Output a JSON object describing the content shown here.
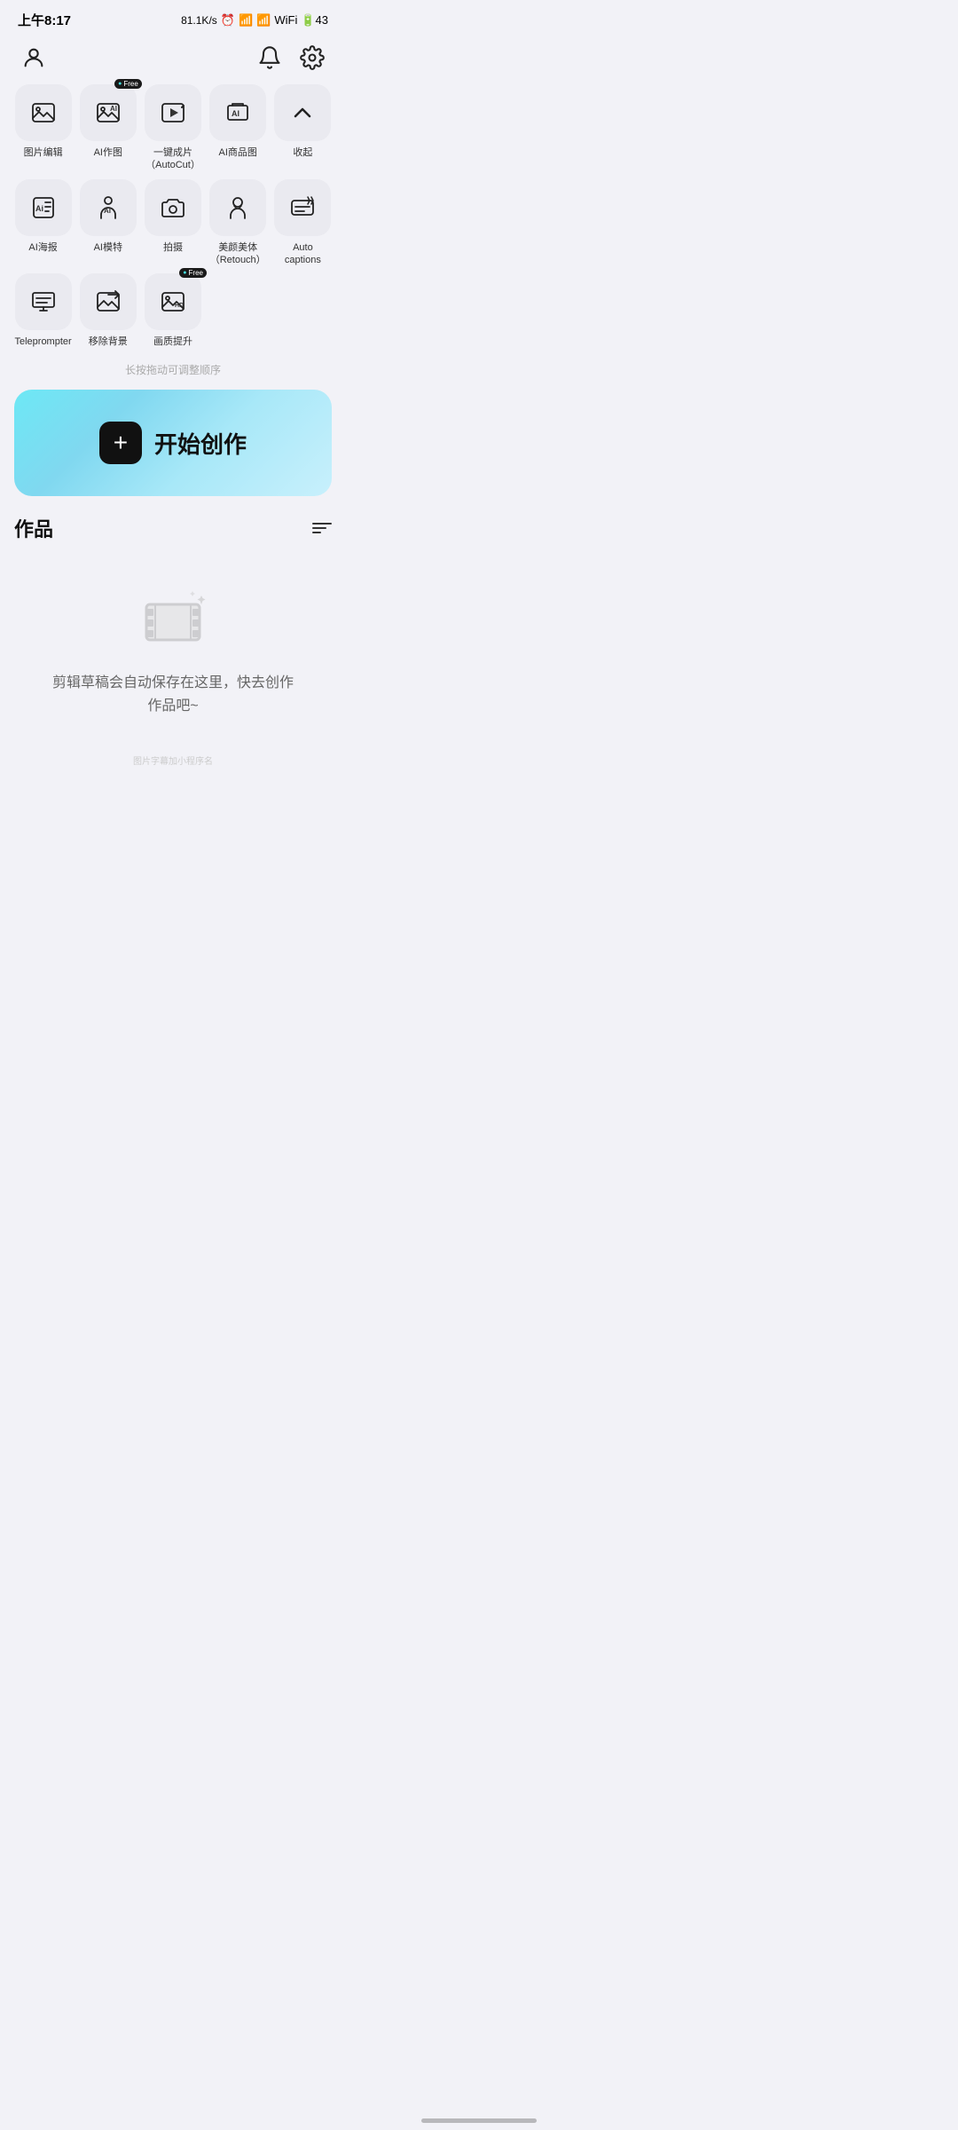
{
  "statusBar": {
    "time": "上午8:17",
    "speed": "81.1K/s",
    "battery": "43"
  },
  "nav": {
    "profileIcon": "user",
    "notificationIcon": "bell",
    "settingsIcon": "settings"
  },
  "toolGrid": {
    "rows": [
      [
        {
          "id": "photo-edit",
          "label": "图片编辑",
          "icon": "photo-edit",
          "badge": null
        },
        {
          "id": "ai-draw",
          "label": "AI作图",
          "icon": "ai-draw",
          "badge": "Free"
        },
        {
          "id": "autocut",
          "label": "一键成片\n（AutoCut）",
          "icon": "autocut",
          "badge": null
        },
        {
          "id": "ai-product",
          "label": "AI商品图",
          "icon": "ai-product",
          "badge": null
        },
        {
          "id": "collapse",
          "label": "收起",
          "icon": "collapse",
          "badge": null
        }
      ],
      [
        {
          "id": "ai-poster",
          "label": "AI海报",
          "icon": "ai-poster",
          "badge": null
        },
        {
          "id": "ai-model",
          "label": "AI模特",
          "icon": "ai-model",
          "badge": null
        },
        {
          "id": "shoot",
          "label": "拍摄",
          "icon": "shoot",
          "badge": null
        },
        {
          "id": "retouch",
          "label": "美颜美体\n（Retouch）",
          "icon": "retouch",
          "badge": null
        },
        {
          "id": "auto-captions",
          "label": "Auto captions",
          "icon": "auto-captions",
          "badge": null
        }
      ],
      [
        {
          "id": "teleprompter",
          "label": "Teleprompter",
          "icon": "teleprompter",
          "badge": null
        },
        {
          "id": "remove-bg",
          "label": "移除背景",
          "icon": "remove-bg",
          "badge": null
        },
        {
          "id": "enhance",
          "label": "画质提升",
          "icon": "enhance",
          "badge": "Free"
        }
      ]
    ]
  },
  "dragHint": "长按拖动可调整顺序",
  "startButton": {
    "plusLabel": "+",
    "label": "开始创作"
  },
  "works": {
    "title": "作品",
    "emptyText": "剪辑草稿会自动保存在这里，快去创作\n作品吧~"
  },
  "watermark": "图片字幕加小程序名"
}
